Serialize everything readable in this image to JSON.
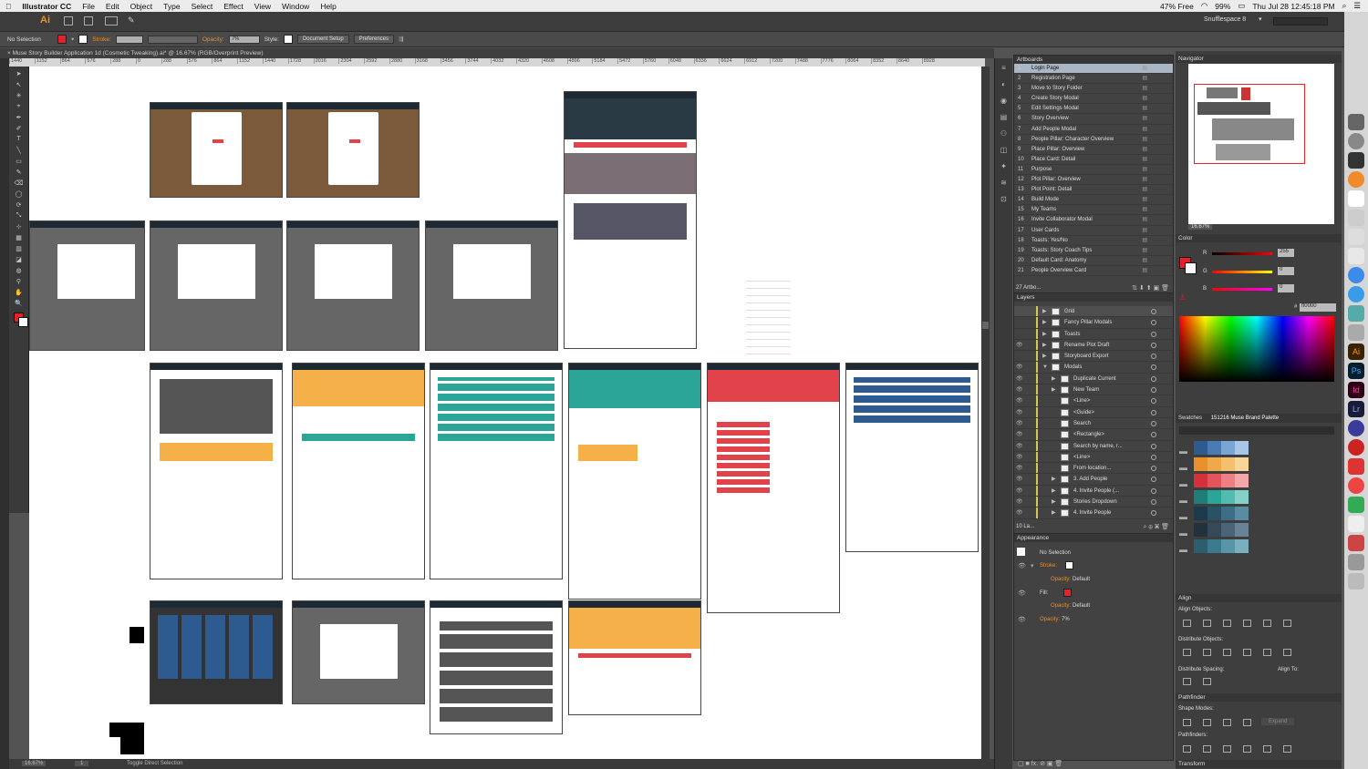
{
  "menubar": {
    "app": "Illustrator CC",
    "items": [
      "File",
      "Edit",
      "Object",
      "Type",
      "Select",
      "Effect",
      "View",
      "Window",
      "Help"
    ],
    "battery": "99%",
    "free": "47% Free",
    "datetime": "Thu Jul 28  12:45:18 PM"
  },
  "appbar": {
    "logo": "Ai",
    "workspace": "Snufflespace 8"
  },
  "control": {
    "selection": "No Selection",
    "stroke_label": "Stroke:",
    "opacity_label": "Opacity:",
    "opacity_value": "7%",
    "style_label": "Style:",
    "doc_setup": "Document Setup",
    "preferences": "Preferences",
    "fill_color": "#e8202a"
  },
  "document": {
    "tab": "Muse Story Builder Application 1d (Cosmetic Tweaking).ai* @ 16.67% (RGB/Overprint Preview)",
    "ruler": [
      "1440",
      "1152",
      "864",
      "576",
      "288",
      "0",
      "288",
      "576",
      "864",
      "1152",
      "1440",
      "1728",
      "2016",
      "2304",
      "2592",
      "2880",
      "3168",
      "3456",
      "3744",
      "4032",
      "4320",
      "4608",
      "4896",
      "5184",
      "5472",
      "5760",
      "6048",
      "6336",
      "6624",
      "6912",
      "7200",
      "7488",
      "7776",
      "8064",
      "8352",
      "8640",
      "8928"
    ],
    "zoom": "16.67%",
    "page": "1",
    "status": "Toggle Direct Selection"
  },
  "artboards_panel": {
    "title": "Artboards",
    "footer": "27 Artbo...",
    "items": [
      {
        "n": "1",
        "name": "Login Page"
      },
      {
        "n": "2",
        "name": "Registration Page"
      },
      {
        "n": "3",
        "name": "Move to Story Folder"
      },
      {
        "n": "4",
        "name": "Create Story Modal"
      },
      {
        "n": "5",
        "name": "Edit Settings Modal"
      },
      {
        "n": "6",
        "name": "Story Overview"
      },
      {
        "n": "7",
        "name": "Add People Modal"
      },
      {
        "n": "8",
        "name": "People  Pillar: Character Overview"
      },
      {
        "n": "9",
        "name": "Place Pillar: Overview"
      },
      {
        "n": "10",
        "name": "Place Card: Detail"
      },
      {
        "n": "11",
        "name": "Purpose"
      },
      {
        "n": "12",
        "name": "Plot Pillar: Overview"
      },
      {
        "n": "13",
        "name": "Plot Point: Detail"
      },
      {
        "n": "14",
        "name": "Build Mode"
      },
      {
        "n": "15",
        "name": "My Teams"
      },
      {
        "n": "16",
        "name": "Invite Collaborator Modal"
      },
      {
        "n": "17",
        "name": "User Cards"
      },
      {
        "n": "18",
        "name": "Toasts: Yes/No"
      },
      {
        "n": "19",
        "name": "Toasts: Story Coach Tips"
      },
      {
        "n": "20",
        "name": "Default Card: Anatomy"
      },
      {
        "n": "21",
        "name": "People Overview Card"
      }
    ]
  },
  "layers_panel": {
    "title": "Layers",
    "footer": "10 La...",
    "items": [
      {
        "name": "Grid",
        "eye": "",
        "tri": "▶"
      },
      {
        "name": "Fancy Pillar Modals",
        "eye": "",
        "tri": "▶"
      },
      {
        "name": "Toasts",
        "eye": "",
        "tri": "▶"
      },
      {
        "name": "Rename Plot Draft",
        "eye": "👁",
        "tri": "▶"
      },
      {
        "name": "Storyboard Export",
        "eye": "",
        "tri": "▶"
      },
      {
        "name": "Modals",
        "eye": "👁",
        "tri": "▼"
      },
      {
        "name": "Duplicate Current",
        "eye": "👁",
        "tri": "▶"
      },
      {
        "name": "New Team",
        "eye": "👁",
        "tri": "▶"
      },
      {
        "name": "<Line>",
        "eye": "👁",
        "tri": ""
      },
      {
        "name": "<Guide>",
        "eye": "👁",
        "tri": ""
      },
      {
        "name": "Search",
        "eye": "👁",
        "tri": ""
      },
      {
        "name": "<Rectangle>",
        "eye": "👁",
        "tri": ""
      },
      {
        "name": "Search by name, r...",
        "eye": "👁",
        "tri": ""
      },
      {
        "name": "<Line>",
        "eye": "👁",
        "tri": ""
      },
      {
        "name": "From location...",
        "eye": "👁",
        "tri": ""
      },
      {
        "name": "3. Add People",
        "eye": "👁",
        "tri": "▶"
      },
      {
        "name": "4. Invite People (...",
        "eye": "👁",
        "tri": "▶"
      },
      {
        "name": "Stories Dropdown",
        "eye": "👁",
        "tri": "▶"
      },
      {
        "name": "4. Invite People",
        "eye": "👁",
        "tri": "▶"
      }
    ]
  },
  "appearance_panel": {
    "title": "Appearance",
    "selection": "No Selection",
    "stroke": "Stroke:",
    "opacity": "Opacity:",
    "opacity_default": "Default",
    "fill": "Fill:",
    "opacity2": "Opacity:",
    "opacity2_default": "Default",
    "opacity_main": "Opacity:",
    "opacity_main_val": "7%"
  },
  "navigator": {
    "title": "Navigator",
    "zoom": "16.67%"
  },
  "color_panel": {
    "title": "Color",
    "r_label": "R",
    "g_label": "G",
    "b_label": "B",
    "r": "255",
    "g": "0",
    "b": "0",
    "hex": "ff0000",
    "hash": "#"
  },
  "swatches_panel": {
    "tab1": "Swatches",
    "tab2": "151216 Muse Brand Palette",
    "colors": [
      [
        "#2e5b8f",
        "#4b7bb5",
        "#7aa6d6",
        "#a8c6e8"
      ],
      [
        "#e8902a",
        "#f0a94a",
        "#f5c06e",
        "#f8d699"
      ],
      [
        "#d6303a",
        "#e5545b",
        "#ee7f84",
        "#f4a7aa"
      ],
      [
        "#1f7d78",
        "#2aa597",
        "#52bcb0",
        "#85d1c9"
      ],
      [
        "#1b3a4a",
        "#2a5266",
        "#3d6e85",
        "#5a8ba3"
      ],
      [
        "#22323d",
        "#34495a",
        "#4a6478",
        "#6a8297"
      ],
      [
        "#2b5e6e",
        "#3b7a8c",
        "#5696a8",
        "#79b0c0"
      ]
    ]
  },
  "align_panel": {
    "title": "Align",
    "align_objects": "Align Objects:",
    "distribute_objects": "Distribute Objects:",
    "distribute_spacing": "Distribute Spacing:",
    "align_to": "Align To:"
  },
  "pathfinder_panel": {
    "title": "Pathfinder",
    "shape_modes": "Shape Modes:",
    "pathfinders": "Pathfinders:",
    "expand": "Expand"
  },
  "transform_panel": {
    "title": "Transform"
  }
}
